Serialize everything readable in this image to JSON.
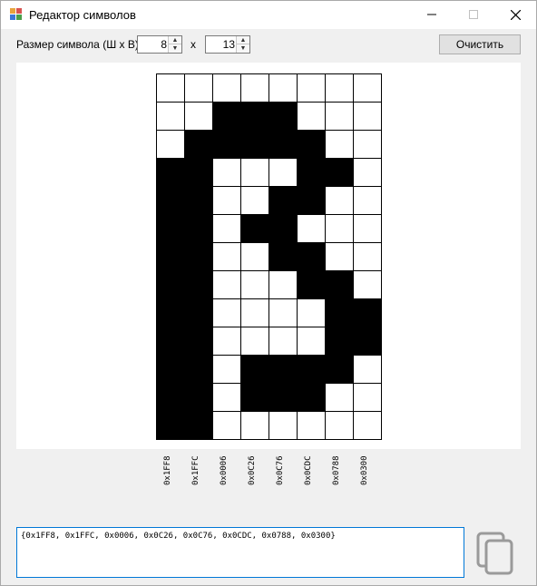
{
  "window": {
    "title": "Редактор символов",
    "minimize_glyph": "—",
    "maximize_glyph": "☐",
    "close_glyph": "✕"
  },
  "controls": {
    "size_label": "Размер символа (Ш x В)",
    "width_value": "8",
    "x_label": "x",
    "height_value": "13",
    "clear_button": "Очистить",
    "spin_up": "▲",
    "spin_down": "▼"
  },
  "glyph": {
    "columns": 8,
    "rows": 13,
    "cells": [
      [
        0,
        0,
        0,
        0,
        0,
        0,
        0,
        0
      ],
      [
        0,
        0,
        1,
        1,
        1,
        0,
        0,
        0
      ],
      [
        0,
        1,
        1,
        1,
        1,
        1,
        0,
        0
      ],
      [
        1,
        1,
        0,
        0,
        0,
        1,
        1,
        0
      ],
      [
        1,
        1,
        0,
        0,
        1,
        1,
        0,
        0
      ],
      [
        1,
        1,
        0,
        1,
        1,
        0,
        0,
        0
      ],
      [
        1,
        1,
        0,
        0,
        1,
        1,
        0,
        0
      ],
      [
        1,
        1,
        0,
        0,
        0,
        1,
        1,
        0
      ],
      [
        1,
        1,
        0,
        0,
        0,
        0,
        1,
        1
      ],
      [
        1,
        1,
        0,
        0,
        0,
        0,
        1,
        1
      ],
      [
        1,
        1,
        0,
        1,
        1,
        1,
        1,
        0
      ],
      [
        1,
        1,
        0,
        1,
        1,
        1,
        0,
        0
      ],
      [
        1,
        1,
        0,
        0,
        0,
        0,
        0,
        0
      ]
    ],
    "column_codes": [
      "0x1FF8",
      "0x1FFC",
      "0x0006",
      "0x0C26",
      "0x0C76",
      "0x0CDC",
      "0x0788",
      "0x0300"
    ]
  },
  "output": {
    "text": "{0x1FF8, 0x1FFC, 0x0006, 0x0C26, 0x0C76, 0x0CDC, 0x0788, 0x0300}"
  },
  "colors": {
    "filled": "#000000",
    "empty": "#ffffff",
    "grid_line": "#000000",
    "accent": "#0078d7"
  }
}
